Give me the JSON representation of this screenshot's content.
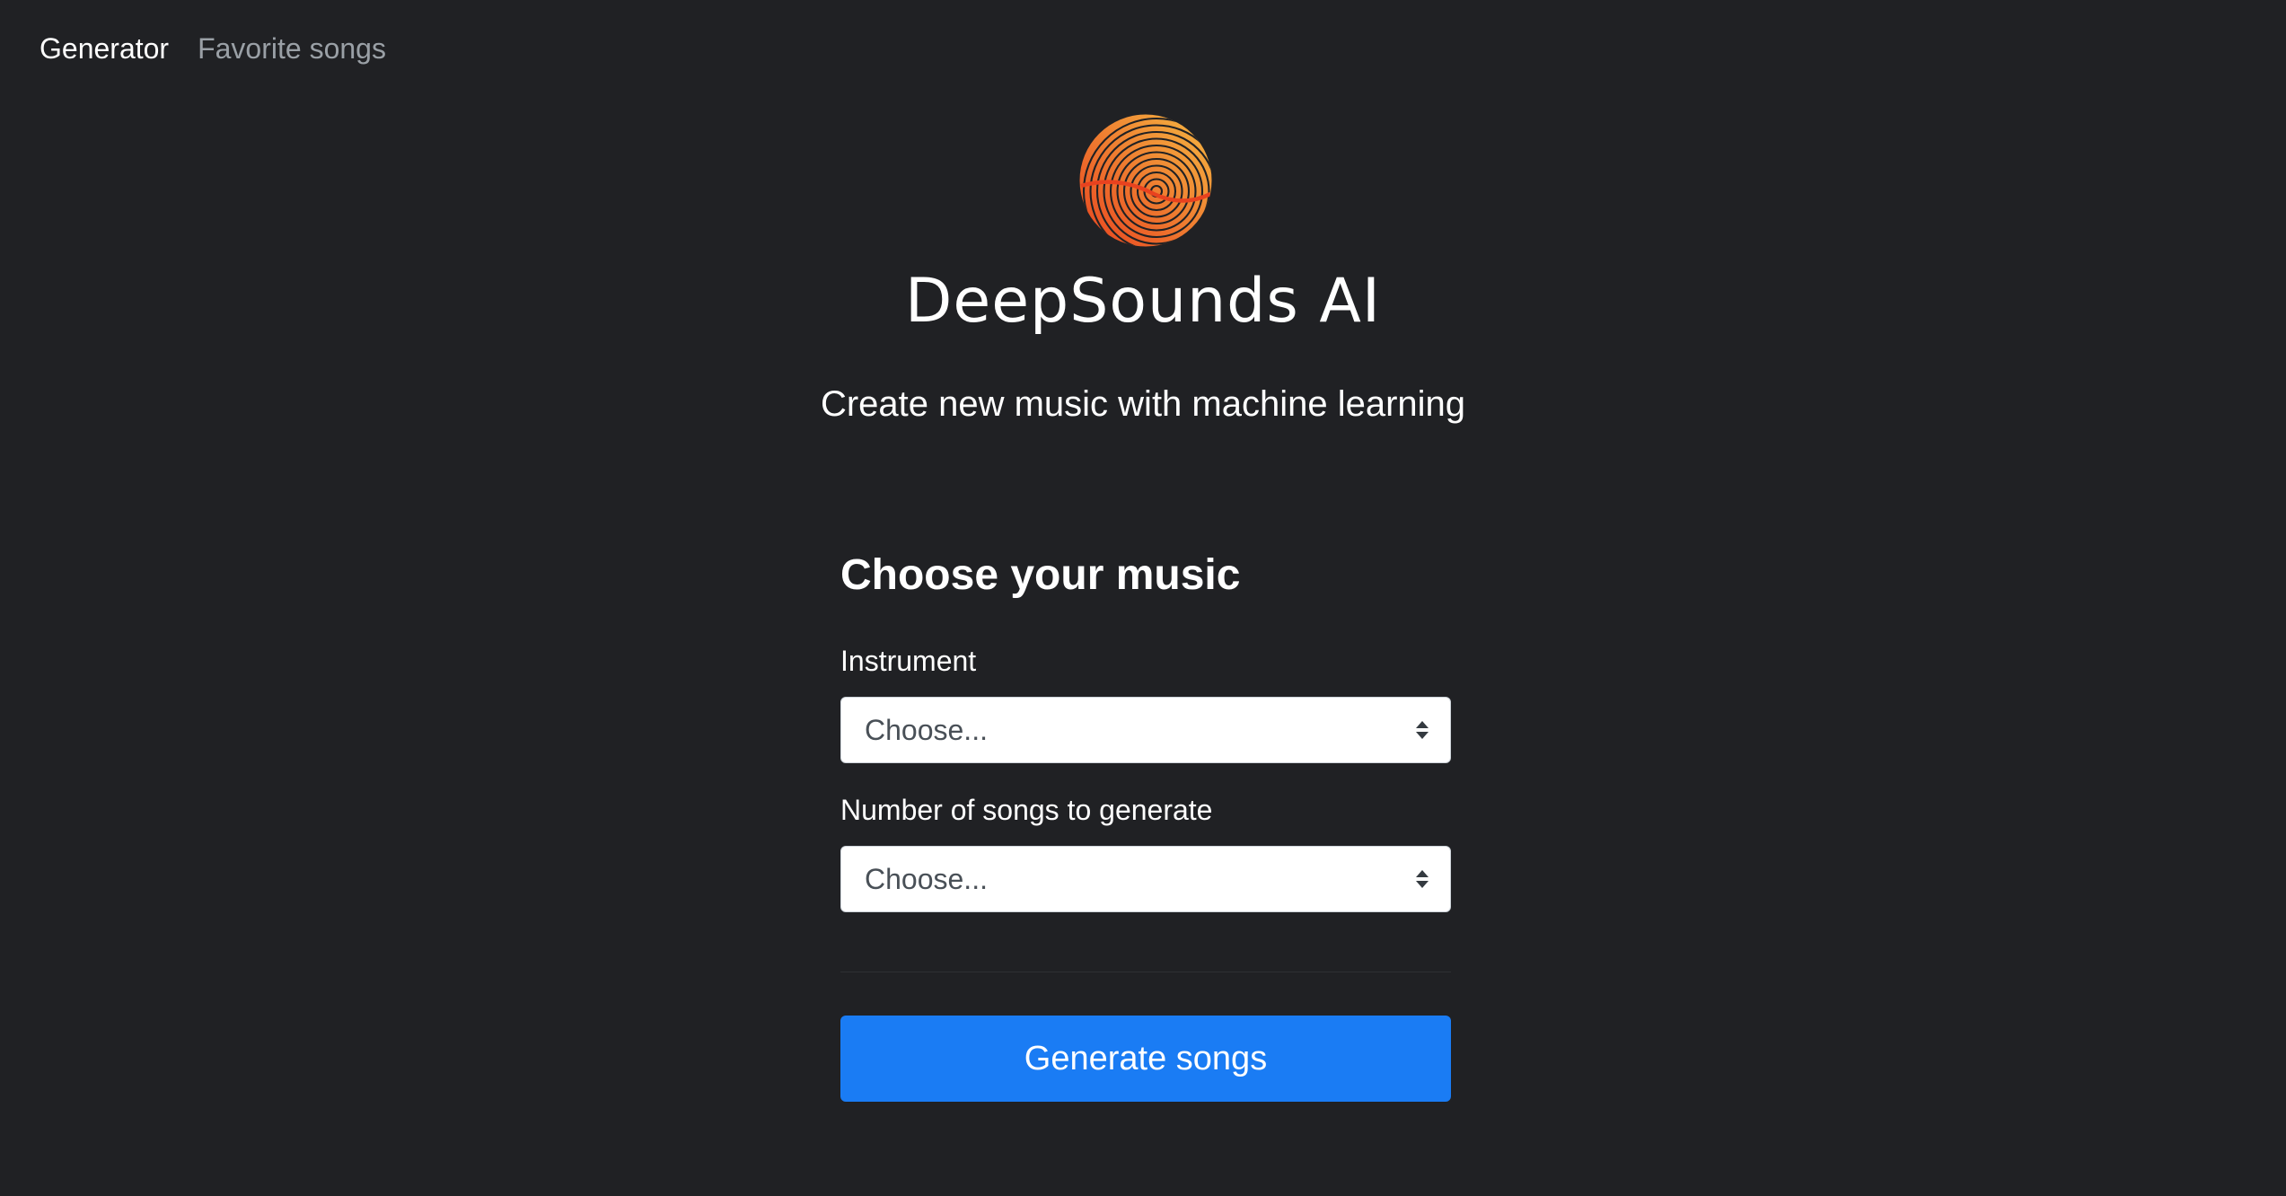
{
  "nav": {
    "items": [
      {
        "label": "Generator",
        "active": true
      },
      {
        "label": "Favorite songs",
        "active": false
      }
    ]
  },
  "brand": {
    "name": "DeepSounds AI",
    "tagline": "Create new music with machine learning",
    "logo_icon": "soundwave-circle-icon"
  },
  "form": {
    "heading": "Choose your music",
    "instrument": {
      "label": "Instrument",
      "value": "Choose..."
    },
    "count": {
      "label": "Number of songs to generate",
      "value": "Choose..."
    },
    "submit_label": "Generate songs"
  },
  "colors": {
    "background": "#202124",
    "accent": "#1a7cf4",
    "logo_start": "#e8421f",
    "logo_end": "#f5b942"
  }
}
